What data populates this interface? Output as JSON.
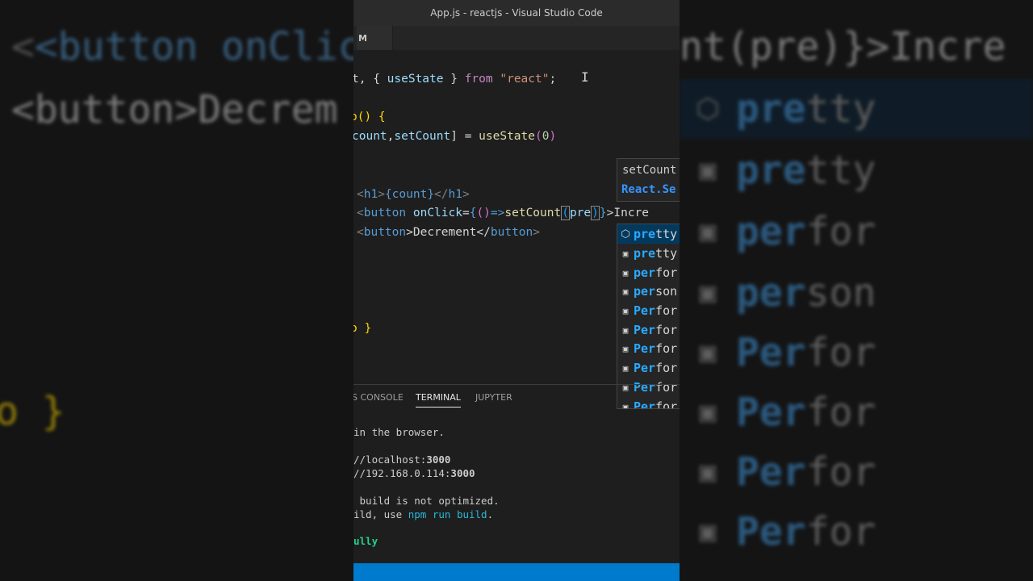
{
  "window": {
    "title": "App.js - reactjs - Visual Studio Code",
    "tab_label": "M"
  },
  "editor": {
    "lines": {
      "import_a": "t, { ",
      "import_b": "useState",
      "import_c": " } ",
      "import_d": "from",
      "import_e": " \"react\"",
      "import_f": ";",
      "fn_a": "o() {",
      "state_a": "count",
      "state_b": ",",
      "state_c": "setCount",
      "state_d": "] = ",
      "state_e": "useState",
      "state_f": "(",
      "state_g": "0",
      "state_h": ")",
      "paren": "(",
      "h1_a": "<",
      "h1_b": "h1",
      "h1_c": ">",
      "h1_d": "{count}",
      "h1_e": "</",
      "h1_f": "h1",
      "h1_g": ">",
      "btn1_a": "<",
      "btn1_b": "button",
      "btn1_c": " onClick",
      "btn1_d": "=",
      "btn1_e": "{",
      "btn1_f": "()",
      "btn1_g": "=>",
      "btn1_h": "setCount",
      "btn1_i": "(",
      "btn1_j": "pre",
      "btn1_k": ")",
      "btn1_l": "}",
      "btn1_m": ">Incre",
      "btn2_a": "<",
      "btn2_b": "button",
      "btn2_c": ">Decrement</",
      "btn2_d": "button",
      "btn2_e": ">",
      "close_a": "o ",
      "close_b": "}"
    },
    "hover": {
      "signature": "setCount",
      "type": "React.Se"
    },
    "suggestions": [
      {
        "match": "pre",
        "rest": "tty",
        "icon": "cube-icon"
      },
      {
        "match": "pre",
        "rest": "tty",
        "icon": "field-icon"
      },
      {
        "match": "per",
        "rest": "for",
        "icon": "field-icon"
      },
      {
        "match": "per",
        "rest": "son",
        "icon": "field-icon"
      },
      {
        "match": "Per",
        "rest": "for",
        "icon": "field-icon"
      },
      {
        "match": "Per",
        "rest": "for",
        "icon": "field-icon"
      },
      {
        "match": "Per",
        "rest": "for",
        "icon": "field-icon"
      },
      {
        "match": "Per",
        "rest": "for",
        "icon": "field-icon"
      },
      {
        "match": "Per",
        "rest": "for",
        "icon": "field-icon"
      },
      {
        "match": "Per",
        "rest": "for",
        "icon": "field-icon"
      }
    ]
  },
  "panel": {
    "tabs": [
      "S CONSOLE",
      "TERMINAL",
      "JUPYTER"
    ],
    "active_tab": "TERMINAL",
    "terminal": {
      "l1": "in the browser.",
      "l2_a": "//localhost:",
      "l2_b": "3000",
      "l3_a": "//192.168.0.114:",
      "l3_b": "3000",
      "l4": " build is not optimized.",
      "l5_a": "ild, use ",
      "l5_b": "npm run build",
      "l5_c": ".",
      "l6": "ully"
    }
  },
  "background": {
    "left_line1": "<button onClic",
    "left_line2": "<button>Decrem",
    "left_line3": "o }",
    "right_line1": "nt(pre)}>Incre",
    "right_items": [
      {
        "text": "pretty",
        "match": "pre",
        "rest": "tty"
      },
      {
        "text": "pretty",
        "match": "pre",
        "rest": "tty"
      },
      {
        "text": "perfor",
        "match": "per",
        "rest": "for"
      },
      {
        "text": "person",
        "match": "per",
        "rest": "son"
      },
      {
        "text": "Perfor",
        "match": "Per",
        "rest": "for"
      },
      {
        "text": "Perfor",
        "match": "Per",
        "rest": "for"
      },
      {
        "text": "Perfor",
        "match": "Per",
        "rest": "for"
      },
      {
        "text": "Perfor",
        "match": "Per",
        "rest": "for"
      }
    ]
  },
  "colors": {
    "accent": "#007acc",
    "suggest_match": "#2aaaff",
    "selected_row": "#04395e"
  }
}
